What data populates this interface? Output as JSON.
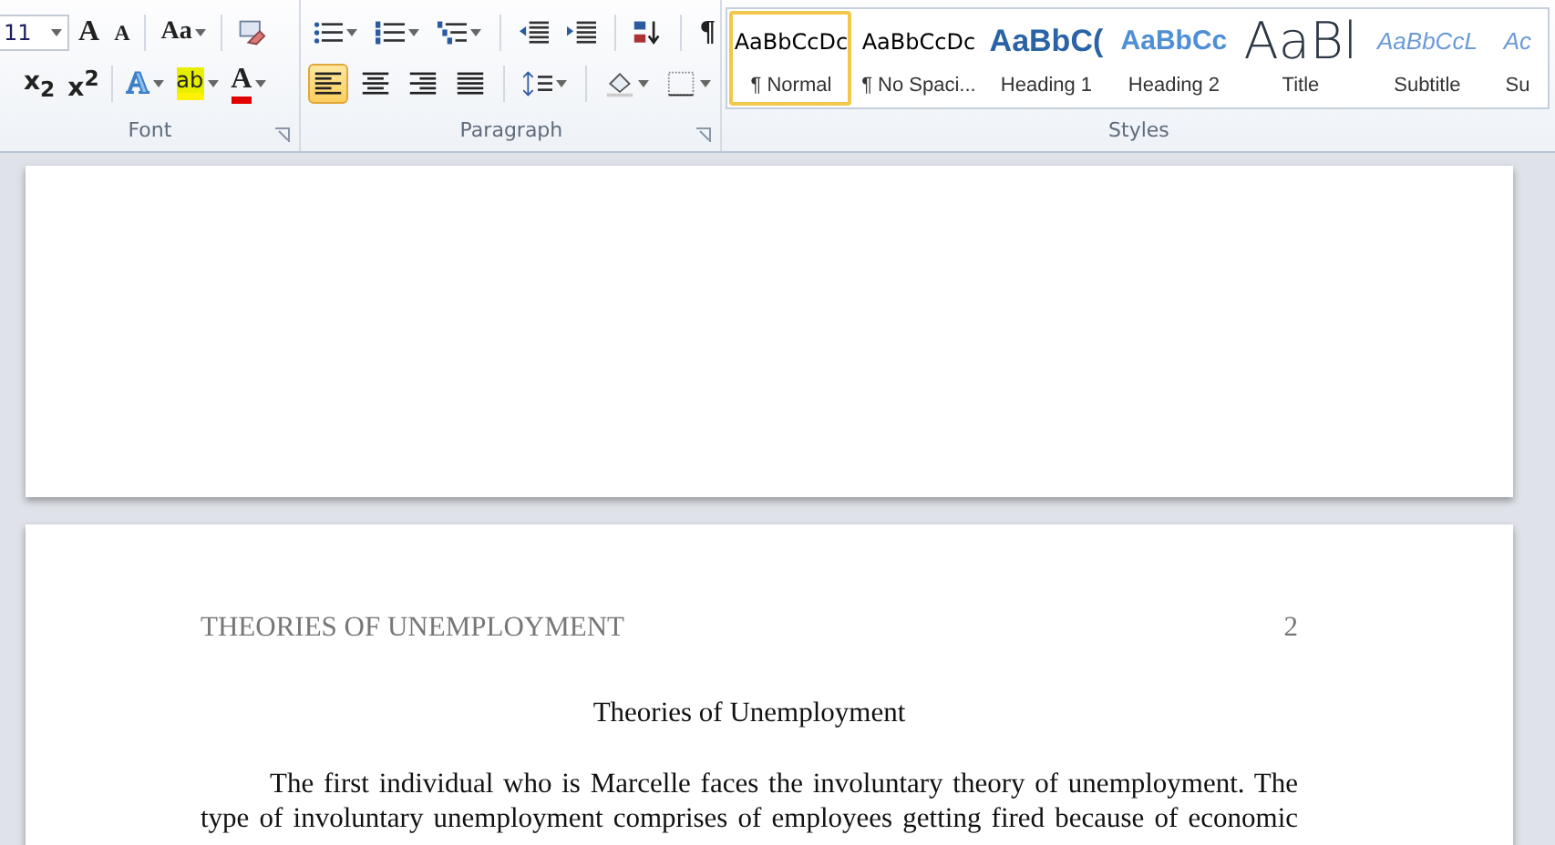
{
  "ribbon": {
    "font": {
      "label": "Font",
      "font_size": "11",
      "row1": [
        {
          "kind": "grow",
          "glyph": "A"
        },
        {
          "kind": "shrink",
          "glyph": "A"
        },
        {
          "kind": "case",
          "glyph": "Aa"
        },
        {
          "kind": "clear"
        }
      ],
      "row2": [
        {
          "kind": "script",
          "glyph": "x$_{2}$"
        },
        {
          "kind": "script",
          "glyph": "x$^{2}$"
        },
        {
          "kind": "effects",
          "glyph": "A"
        },
        {
          "kind": "highlight",
          "glyph": "ab"
        },
        {
          "kind": "color",
          "glyph": "A"
        }
      ]
    },
    "paragraph": {
      "label": "Paragraph",
      "row1": [
        {
          "kind": "bullets"
        },
        {
          "kind": "numbering"
        },
        {
          "kind": "multilevel"
        },
        {
          "kind": "outdent"
        },
        {
          "kind": "indent"
        },
        {
          "kind": "sort"
        },
        {
          "kind": "pilcrow",
          "glyph": "¶"
        }
      ],
      "align": [
        {
          "kind": "left",
          "selected": true
        },
        {
          "kind": "center",
          "selected": false
        },
        {
          "kind": "right",
          "selected": false
        },
        {
          "kind": "justify",
          "selected": false
        }
      ],
      "row2": [
        {
          "kind": "spacing"
        },
        {
          "kind": "shading"
        },
        {
          "kind": "borders"
        }
      ]
    },
    "styles": {
      "label": "Styles",
      "items": [
        {
          "kind": "normal",
          "preview": "AaBbCcDc",
          "label": "¶ Normal",
          "selected": true
        },
        {
          "kind": "normal",
          "preview": "AaBbCcDc",
          "label": "¶ No Spaci...",
          "selected": false
        },
        {
          "kind": "h1",
          "preview": "AaBbC(",
          "label": "Heading 1",
          "selected": false
        },
        {
          "kind": "h2",
          "preview": "AaBbCc",
          "label": "Heading 2",
          "selected": false
        },
        {
          "kind": "title",
          "preview": "AaBl",
          "label": "Title",
          "selected": false
        },
        {
          "kind": "subtitle",
          "preview": "AaBbCcL",
          "label": "Subtitle",
          "selected": false
        },
        {
          "kind": "subtitle",
          "preview": "Ac",
          "label": "Su",
          "selected": false
        }
      ]
    }
  },
  "document": {
    "header": "THEORIES OF UNEMPLOYMENT",
    "page_number": "2",
    "title": "Theories of Unemployment",
    "body": "The first individual who is Marcelle faces the involuntary theory of unemployment. The type of involuntary unemployment comprises of employees getting fired because of economic"
  }
}
